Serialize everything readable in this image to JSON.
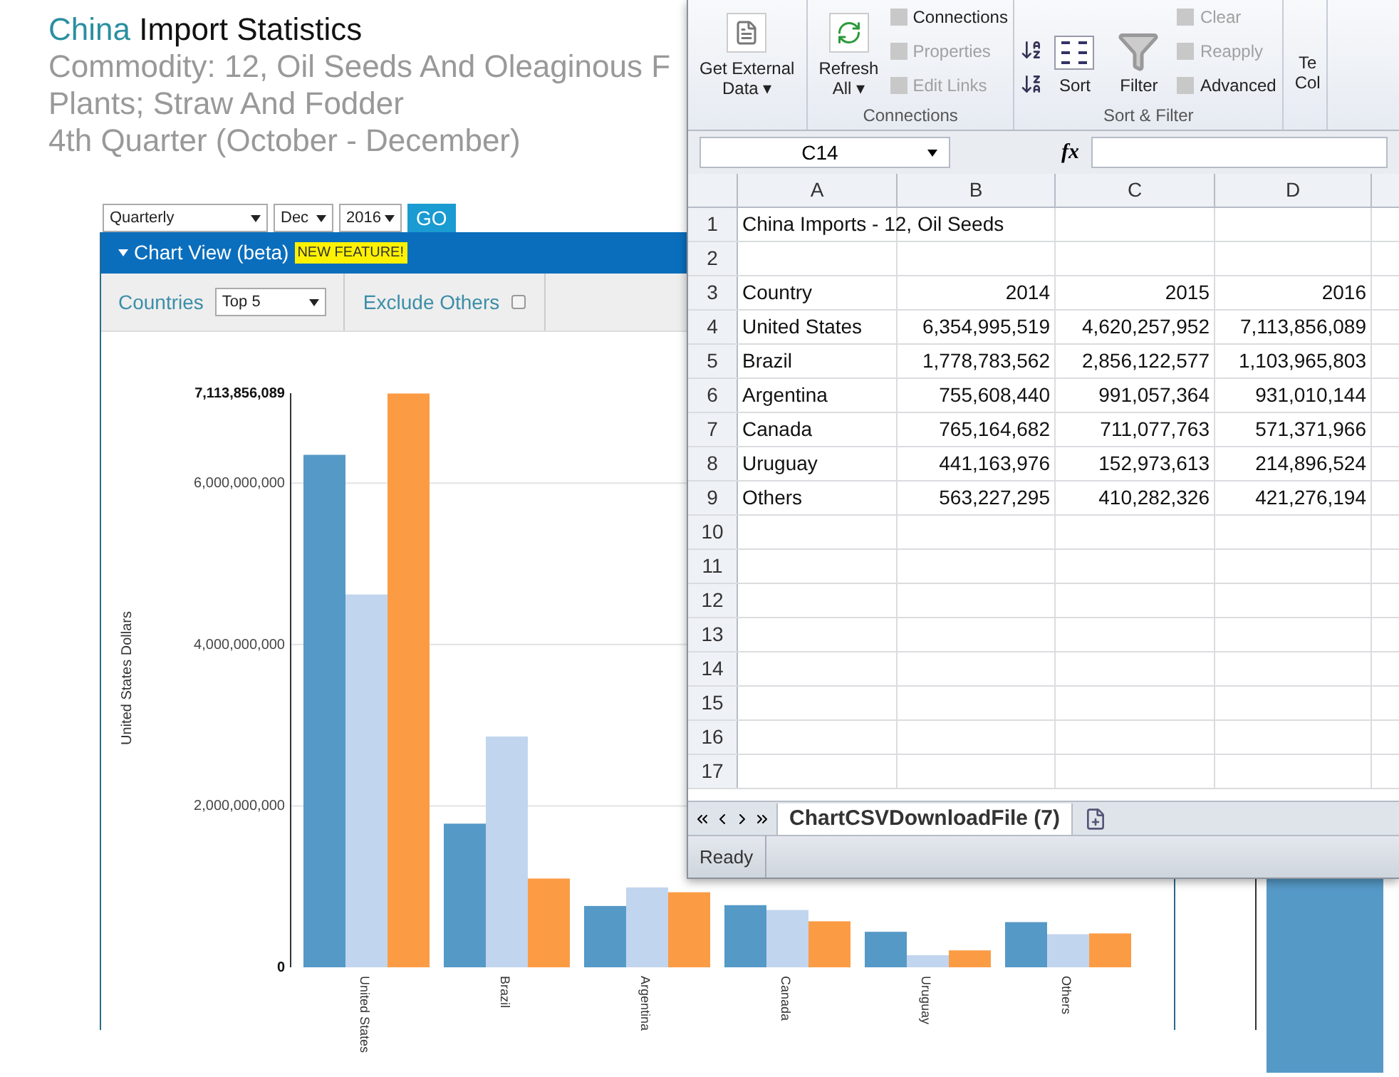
{
  "page": {
    "title_highlight": "China",
    "title_rest": "Import Statistics",
    "subtitle_lines": [
      "Commodity: 12, Oil Seeds And Oleaginous F",
      "Plants; Straw And Fodder",
      "4th Quarter (October - December)"
    ],
    "controls": {
      "period": "Quarterly",
      "month": "Dec",
      "year": "2016",
      "go": "GO"
    },
    "chart_header": {
      "title": "Chart View (beta)",
      "badge": "NEW FEATURE!"
    },
    "filters": {
      "countries_label": "Countries",
      "countries_value": "Top 5",
      "exclude_label": "Exclude Others",
      "exclude_checked": false
    },
    "chart": {
      "chart_data": {
        "type": "bar",
        "ylabel": "United States Dollars",
        "categories": [
          "United States",
          "Brazil",
          "Argentina",
          "Canada",
          "Uruguay",
          "Others"
        ],
        "grid": true,
        "series": [
          {
            "color": "#5599c7",
            "values": [
              6350000000,
              1780000000,
              760000000,
              770000000,
              440000000,
              560000000
            ]
          },
          {
            "color": "#c2d5ee",
            "values": [
              4620000000,
              2860000000,
              990000000,
              710000000,
              150000000,
              410000000
            ]
          },
          {
            "color": "#fb9c45",
            "values": [
              7110000000,
              1100000000,
              930000000,
              570000000,
              210000000,
              420000000
            ]
          }
        ],
        "ylim": [
          0,
          7113856089
        ],
        "yticks": [
          {
            "value": 0,
            "label": "0"
          },
          {
            "value": 2000000000,
            "label": "2,000,000,000"
          },
          {
            "value": 4000000000,
            "label": "4,000,000,000"
          },
          {
            "value": 6000000000,
            "label": "6,000,000,000"
          },
          {
            "value": 7113856089,
            "label": "7,113,856,089"
          }
        ]
      }
    }
  },
  "excel": {
    "ribbon": {
      "groups": [
        {
          "buttons": [
            {
              "label": "Get External Data ▾",
              "kind": "large"
            }
          ]
        },
        {
          "label": "Connections",
          "buttons": [
            {
              "label": "Refresh All ▾",
              "kind": "large"
            },
            {
              "label": "Connections",
              "kind": "small",
              "disabled": false
            },
            {
              "label": "Properties",
              "kind": "small",
              "disabled": true
            },
            {
              "label": "Edit Links",
              "kind": "small",
              "disabled": true
            }
          ]
        },
        {
          "label": "Sort & Filter",
          "buttons": [
            {
              "label": "Sort",
              "kind": "sort"
            },
            {
              "label": "Filter",
              "kind": "filter"
            },
            {
              "label": "Clear",
              "kind": "small",
              "disabled": true
            },
            {
              "label": "Reapply",
              "kind": "small",
              "disabled": true
            },
            {
              "label": "Advanced",
              "kind": "small",
              "disabled": false
            }
          ]
        },
        {
          "buttons": [
            {
              "label": "Te Col",
              "kind": "cut"
            }
          ]
        }
      ]
    },
    "name_box": "C14",
    "fx": "fx",
    "columns": [
      "A",
      "B",
      "C",
      "D"
    ],
    "rows": [
      {
        "number": "1",
        "cells": [
          "China Imports - 12, Oil Seeds",
          "",
          "",
          ""
        ]
      },
      {
        "number": "2",
        "cells": [
          "",
          "",
          "",
          ""
        ]
      },
      {
        "number": "3",
        "cells": [
          "Country",
          "2014",
          "2015",
          "2016"
        ]
      },
      {
        "number": "4",
        "cells": [
          "United States",
          "6,354,995,519",
          "4,620,257,952",
          "7,113,856,089"
        ]
      },
      {
        "number": "5",
        "cells": [
          "Brazil",
          "1,778,783,562",
          "2,856,122,577",
          "1,103,965,803"
        ]
      },
      {
        "number": "6",
        "cells": [
          "Argentina",
          "755,608,440",
          "991,057,364",
          "931,010,144"
        ]
      },
      {
        "number": "7",
        "cells": [
          "Canada",
          "765,164,682",
          "711,077,763",
          "571,371,966"
        ]
      },
      {
        "number": "8",
        "cells": [
          "Uruguay",
          "441,163,976",
          "152,973,613",
          "214,896,524"
        ]
      },
      {
        "number": "9",
        "cells": [
          "Others",
          "563,227,295",
          "410,282,326",
          "421,276,194"
        ]
      },
      {
        "number": "10",
        "cells": [
          "",
          "",
          "",
          ""
        ]
      },
      {
        "number": "11",
        "cells": [
          "",
          "",
          "",
          ""
        ]
      },
      {
        "number": "12",
        "cells": [
          "",
          "",
          "",
          ""
        ]
      },
      {
        "number": "13",
        "cells": [
          "",
          "",
          "",
          ""
        ]
      },
      {
        "number": "14",
        "cells": [
          "",
          "",
          "",
          ""
        ]
      },
      {
        "number": "15",
        "cells": [
          "",
          "",
          "",
          ""
        ]
      },
      {
        "number": "16",
        "cells": [
          "",
          "",
          "",
          ""
        ]
      },
      {
        "number": "17",
        "cells": [
          "",
          "",
          "",
          ""
        ]
      }
    ],
    "sheet_tab": "ChartCSVDownloadFile (7)",
    "status": "Ready"
  }
}
